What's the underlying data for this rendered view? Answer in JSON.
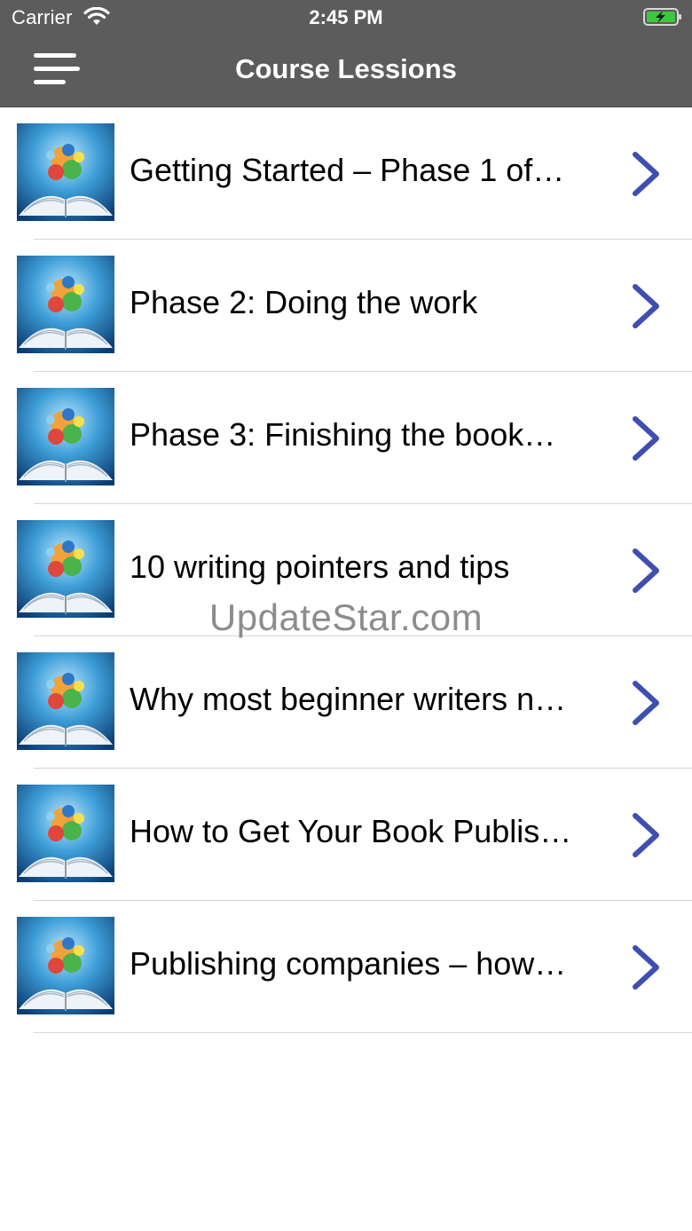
{
  "status_bar": {
    "carrier": "Carrier",
    "time": "2:45 PM",
    "wifi_icon": "wifi-icon",
    "battery_icon": "battery-charging-icon"
  },
  "nav": {
    "title": "Course Lessions",
    "menu_icon": "menu-icon"
  },
  "lessons": [
    {
      "label": "Getting Started – Phase 1 of…"
    },
    {
      "label": "Phase 2: Doing the work"
    },
    {
      "label": "Phase 3: Finishing the book…"
    },
    {
      "label": "10 writing pointers and tips"
    },
    {
      "label": "Why most beginner writers n…"
    },
    {
      "label": "How to Get Your Book Publis…"
    },
    {
      "label": "Publishing companies – how…"
    }
  ],
  "watermark": "UpdateStar.com",
  "colors": {
    "nav_bar": "#5c5c5c",
    "chevron": "#3f4fb0",
    "battery_fill": "#3fc63f"
  }
}
